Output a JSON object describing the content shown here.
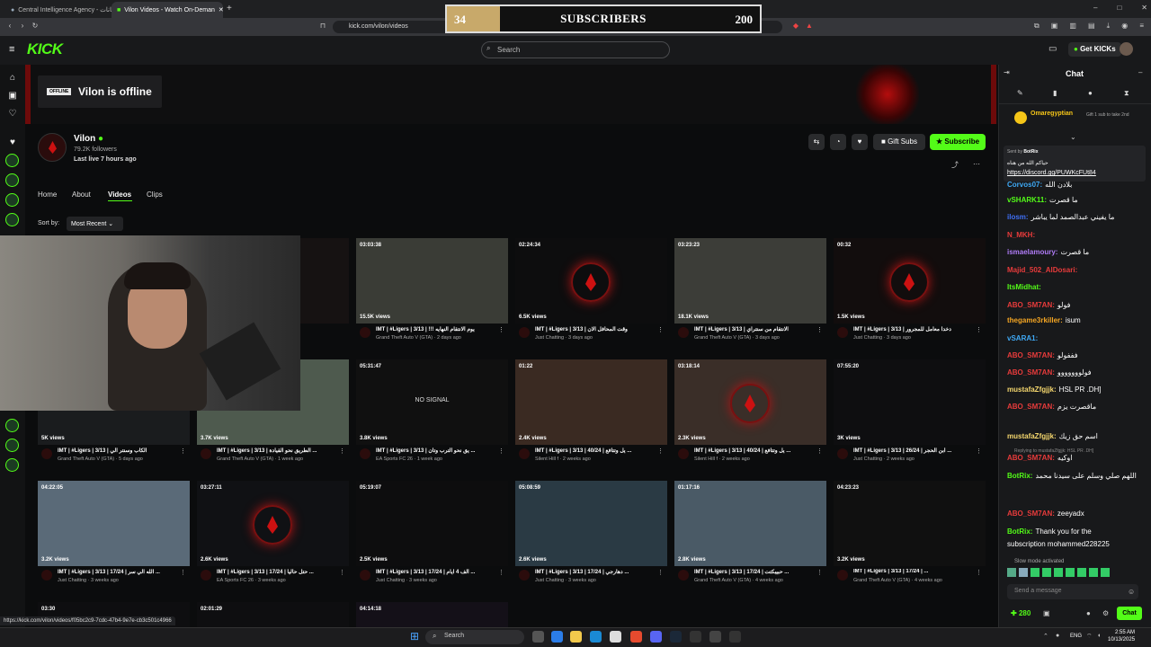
{
  "browser": {
    "tabs": [
      {
        "title": "Central Intelligence Agency - بيانات"
      },
      {
        "title": "Vilon Videos - Watch On-Deman"
      }
    ],
    "url": "kick.com/vilon/videos",
    "status_url": "https://kick.com/vilon/videos/f05bc2c9-7cdc-47b4-9e7e-cb3c501c4966"
  },
  "overlay": {
    "left_value": "34",
    "title": "SUBSCRIBERS",
    "right_value": "200",
    "progress": 0.17
  },
  "header": {
    "search_placeholder": "Search",
    "get_kicks": "Get KICKs"
  },
  "banner": {
    "offline_badge": "OFFLINE",
    "offline_text": "Vilon is offline"
  },
  "channel": {
    "name": "Vilon",
    "followers": "79.2K followers",
    "last_live": "Last live 7 hours ago",
    "gift_subs": "Gift Subs",
    "subscribe": "Subscribe"
  },
  "nav_tabs": [
    "Home",
    "About",
    "Videos",
    "Clips"
  ],
  "sort": {
    "label": "Sort by:",
    "value": "Most Recent"
  },
  "videos": [
    {
      "duration": "",
      "views": "",
      "title": "",
      "meta": "ours ago"
    },
    {
      "duration": "03:03:38",
      "views": "15.5K views",
      "title": "IMT | #Ligers | 3/13 | !!! يوم الانتقام النهايه",
      "meta": "Grand Theft Auto V (GTA) · 2 days ago"
    },
    {
      "duration": "02:24:34",
      "views": "6.5K views",
      "title": "IMT | #Ligers | 3/13 | وقت المحافل الان",
      "meta": "Just Chatting · 3 days ago"
    },
    {
      "duration": "03:23:23",
      "views": "18.1K views",
      "title": "IMT | #Ligers | 3/13 | الانتقام من سنتراي",
      "meta": "Grand Theft Auto V (GTA) · 3 days ago"
    },
    {
      "duration": "00:32",
      "views": "1.5K views",
      "title": "IMT | #Ligers | 3/13 | دخدا معامل للمجرور",
      "meta": "Just Chatting · 3 days ago"
    },
    {
      "duration": "",
      "views": "5K views",
      "title": "IMT | #Ligers | 3/13 | الكاب وسنتر الي",
      "meta": "Grand Theft Auto V (GTA) · 5 days ago"
    },
    {
      "duration": "",
      "views": "3.7K views",
      "title": "IMT | #Ligers | 3/13 | الطريق نحو القيادة ...",
      "meta": "Grand Theft Auto V (GTA) · 1 week ago"
    },
    {
      "duration": "05:31:47",
      "views": "3.8K views",
      "title": "IMT | #Ligers | 3/13 | يق نحو الترب وتان ...",
      "meta": "EA Sports FC 26 · 1 week ago"
    },
    {
      "duration": "01:22",
      "views": "2.4K views",
      "title": "IMT | #Ligers | 3/13 | 40/24 | يل وتتافع ...",
      "meta": "Silent Hill f · 2 weeks ago"
    },
    {
      "duration": "03:18:14",
      "views": "2.3K views",
      "title": "IMT | #Ligers | 3/13 | 40/24 | يل وتتافع ...",
      "meta": "Silent Hill f · 2 weeks ago"
    },
    {
      "duration": "07:55:20",
      "views": "3K views",
      "title": "IMT | #Ligers | 3/13 | 26/24 | ابن الحجر ...",
      "meta": "Just Chatting · 2 weeks ago"
    },
    {
      "duration": "04:22:05",
      "views": "3.2K views",
      "title": "IMT | #Ligers | 3/13 | 17/24 | الله الي سر ...",
      "meta": "Just Chatting · 3 weeks ago"
    },
    {
      "duration": "03:27:11",
      "views": "2.6K views",
      "title": "IMT | #Ligers | 3/13 | 17/24 | حتل حاليا ...",
      "meta": "EA Sports FC 26 · 3 weeks ago"
    },
    {
      "duration": "05:19:07",
      "views": "2.5K views",
      "title": "IMT | #Ligers | 3/13 | 17/24 | الف 4 ايام ...",
      "meta": "Just Chatting · 3 weeks ago"
    },
    {
      "duration": "05:08:59",
      "views": "2.6K views",
      "title": "IMT | #Ligers | 3/13 | 17/24 | دهارجي ...",
      "meta": "Just Chatting · 3 weeks ago"
    },
    {
      "duration": "01:17:16",
      "views": "2.8K views",
      "title": "IMT | #Ligers | 3/13 | 17/24 | حبيبكتت ...",
      "meta": "Grand Theft Auto V (GTA) · 4 weeks ago"
    },
    {
      "duration": "04:23:23",
      "views": "3.2K views",
      "title": "IMT | #Ligers | 3/13 | 17/24 | ...",
      "meta": "Grand Theft Auto V (GTA) · 4 weeks ago"
    },
    {
      "duration": "03:30",
      "views": "",
      "title": "",
      "meta": ""
    },
    {
      "duration": "02:01:29",
      "views": "",
      "title": "",
      "meta": ""
    },
    {
      "duration": "04:14:18",
      "views": "",
      "title": "",
      "meta": ""
    }
  ],
  "no_signal": "NO SIGNAL",
  "chat": {
    "title": "Chat",
    "gift_leader": "Omaregyptian",
    "gift_note": "Gift 1 sub to take 2nd",
    "pinned_sender": "Sent by",
    "pinned_user": "BotRix",
    "pinned_text": "حياكم الله من هناه",
    "pinned_link": "https://discord.gg/PUWKcFUt84",
    "messages": [
      {
        "user": "Corvos07:",
        "text": "بلادن الله",
        "color": "#3fa9f5"
      },
      {
        "user": "vSHARK11:",
        "text": "ما قصرت",
        "color": "#53fc18"
      },
      {
        "user": "ilosm:",
        "text": "ما يفيني عبدالصمد لما يباشر",
        "color": "#3f6ff5"
      },
      {
        "user": "N_MKH:",
        "text": "",
        "color": "#e83b3b"
      },
      {
        "user": "ismaelamoury:",
        "text": "ما قصرت",
        "color": "#b07cf7"
      },
      {
        "user": "Majid_502_AlDosari:",
        "text": "",
        "color": "#e83b3b"
      },
      {
        "user": "ItsMidhat:",
        "text": "",
        "color": "#53fc18"
      },
      {
        "user": "ABO_SM7AN:",
        "text": "فولو",
        "color": "#e83b3b"
      },
      {
        "user": "thegame3rkiller:",
        "text": "isum",
        "color": "#f5a623"
      },
      {
        "user": "vSARA1:",
        "text": "",
        "color": "#3fa9f5"
      },
      {
        "user": "ABO_SM7AN:",
        "text": "فففولو",
        "color": "#e83b3b"
      },
      {
        "user": "ABO_SM7AN:",
        "text": "فولووووووو",
        "color": "#e83b3b"
      },
      {
        "user": "mustafaZfgjjk:",
        "text": "HSL PR .DH]",
        "color": "#f5d76e"
      },
      {
        "user": "ABO_SM7AN:",
        "text": "ماقصرت يزم",
        "color": "#e83b3b"
      },
      {
        "user": "mustafaZfgjjk:",
        "text": "اسم حق زيك",
        "color": "#f5d76e"
      },
      {
        "user": "ABO_SM7AN:",
        "text": "اوكيه",
        "color": "#e83b3b"
      },
      {
        "user": "BotRix:",
        "text": "اللهم صلي وسلم على سيدنا محمد",
        "color": "#53fc18"
      },
      {
        "user": "ABO_SM7AN:",
        "text": "zeeyadx",
        "color": "#e83b3b"
      },
      {
        "user": "BotRix:",
        "text": "Thank you for the",
        "color": "#53fc18"
      },
      {
        "user": "",
        "text": "subscription mohammed228225",
        "color": "#ffffff"
      }
    ],
    "reply_note": "Replying to mustafaZfgjjk: HSL PR .DH]",
    "slow_mode": "Slow mode activated",
    "input_placeholder": "Send a message",
    "kicks": "280",
    "send": "Chat"
  },
  "taskbar": {
    "search": "Search",
    "lang": "ENG",
    "time": "2:55 AM",
    "date": "10/13/2025"
  }
}
